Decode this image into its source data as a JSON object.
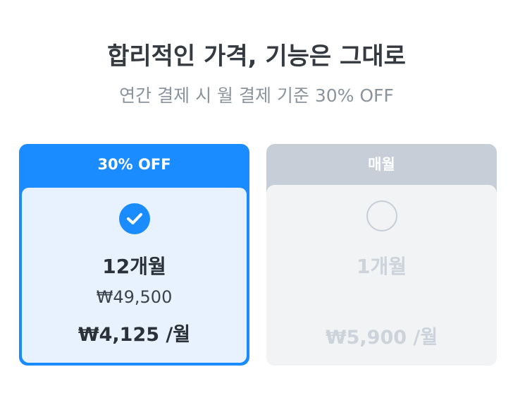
{
  "header": {
    "title": "합리적인 가격, 기능은 그대로",
    "subtitle": "연간 결제 시 월 결제 기준 30% OFF"
  },
  "plans": [
    {
      "badge": "30% OFF",
      "period": "12개월",
      "full_price": "₩49,500",
      "monthly_price": "₩4,125 /월",
      "selected": true
    },
    {
      "badge": "매월",
      "period": "1개월",
      "monthly_price": "₩5,900 /월",
      "selected": false
    }
  ],
  "colors": {
    "accent": "#1a8cff",
    "selected_bg": "#e7f2fe",
    "unselected_header": "#c7ced7",
    "unselected_bg": "#f1f3f5"
  },
  "icons": {
    "selected": "checkmark-circle-icon",
    "unselected": "empty-circle-icon"
  }
}
